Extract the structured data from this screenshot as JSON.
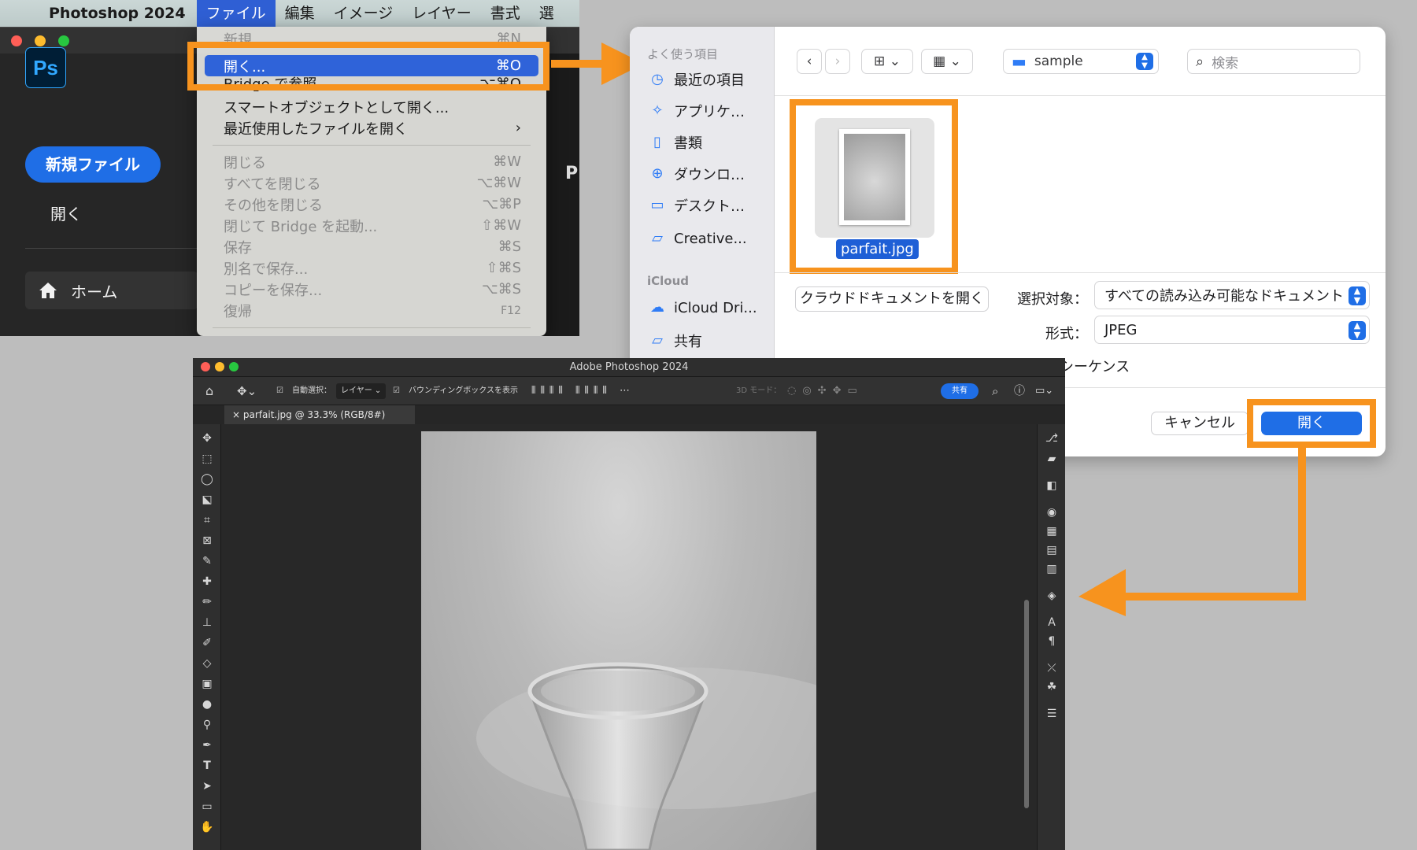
{
  "menubar": {
    "app_name": "Photoshop 2024",
    "items": [
      "ファイル",
      "編集",
      "イメージ",
      "レイヤー",
      "書式",
      "選"
    ]
  },
  "ps_home": {
    "logo": "Ps",
    "new_file": "新規ファイル",
    "open": "開く",
    "home": "ホーム",
    "partial_text": "Pl"
  },
  "file_menu": {
    "items": [
      {
        "label": "新規",
        "shortcut": "⌘N"
      },
      {
        "label": "開く...",
        "shortcut": "⌘O"
      },
      {
        "label": "Bridge で参照...",
        "shortcut": "⌥⌘O"
      },
      {
        "label": "スマートオブジェクトとして開く...",
        "shortcut": ""
      },
      {
        "label": "最近使用したファイルを開く",
        "shortcut": "›"
      },
      {
        "label": "閉じる",
        "shortcut": "⌘W"
      },
      {
        "label": "すべてを閉じる",
        "shortcut": "⌥⌘W"
      },
      {
        "label": "その他を閉じる",
        "shortcut": "⌥⌘P"
      },
      {
        "label": "閉じて Bridge を起動...",
        "shortcut": "⇧⌘W"
      },
      {
        "label": "保存",
        "shortcut": "⌘S"
      },
      {
        "label": "別名で保存...",
        "shortcut": "⇧⌘S"
      },
      {
        "label": "コピーを保存...",
        "shortcut": "⌥⌘S"
      },
      {
        "label": "復帰",
        "shortcut": "F12"
      }
    ]
  },
  "dialog": {
    "sidebar": {
      "favorites_label": "よく使う項目",
      "favorites": [
        "最近の項目",
        "アプリケ…",
        "書類",
        "ダウンロ…",
        "デスクト…",
        "Creative..."
      ],
      "icloud_label": "iCloud",
      "icloud": [
        "iCloud Dri...",
        "共有"
      ]
    },
    "folder": "sample",
    "search_placeholder": "検索",
    "file_name": "parfait.jpg",
    "cloud_button": "クラウドドキュメントを開く",
    "select_label": "選択対象：",
    "select_value": "すべての読み込み可能なドキュメント",
    "format_label": "形式：",
    "format_value": "JPEG",
    "image_sequence": "画像シーケンス",
    "cancel": "キャンセル",
    "open": "開く"
  },
  "ps_doc": {
    "window_title": "Adobe Photoshop 2024",
    "auto_select_label": "自動選択：",
    "auto_select_value": "レイヤー",
    "bbox_label": "バウンディングボックスを表示",
    "mode_3d": "3D モード：",
    "share": "共有",
    "tab": "parfait.jpg @ 33.3% (RGB/8#)"
  },
  "colors": {
    "accent": "#f7931e",
    "blue": "#1f6ee6"
  }
}
